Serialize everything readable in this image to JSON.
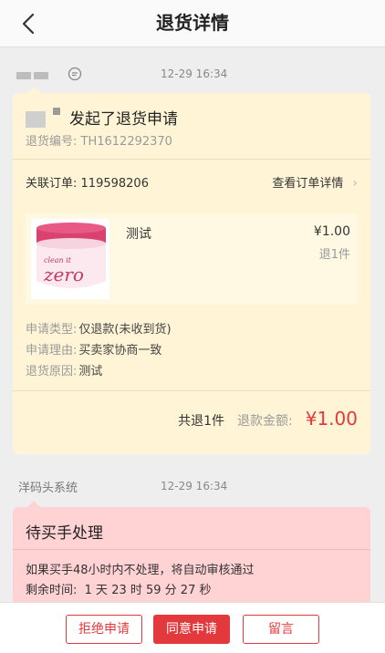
{
  "header": {
    "title": "退货详情",
    "back_icon": "chevron-left-icon"
  },
  "message1": {
    "time": "12-29 16:34",
    "chat_icon": "chat-bubble-icon",
    "action_text": "发起了退货申请",
    "return_no_label": "退货编号:",
    "return_no": "TH1612292370",
    "order_label": "关联订单:",
    "order_no": "119598206",
    "view_order": "查看订单详情",
    "view_order_icon": "chevron-right-icon",
    "product": {
      "name": "测试",
      "price": "¥1.00",
      "qty": "退1件",
      "image_brand_small": "clean it",
      "image_brand_big": "zero"
    },
    "apply_type_label": "申请类型:",
    "apply_type": "仅退款(未收到货)",
    "apply_reason_label": "申请理由:",
    "apply_reason": "买卖家协商一致",
    "return_reason_label": "退货原因:",
    "return_reason": "测试",
    "total_count": "共退1件",
    "refund_label": "退款金额:",
    "refund_amount": "¥1.00"
  },
  "message2": {
    "sender": "洋码头系统",
    "time": "12-29 16:34",
    "title": "待买手处理",
    "note": "如果买手48小时内不处理，将自动审核通过",
    "remain_label": "剩余时间:",
    "remain_value": "1 天 23 时 59 分 27 秒"
  },
  "actions": {
    "reject": "拒绝申请",
    "agree": "同意申请",
    "message": "留言"
  },
  "colors": {
    "accent": "#e4393c",
    "card_yellow": "#fff5d6",
    "card_pink": "#ffd2d4"
  }
}
